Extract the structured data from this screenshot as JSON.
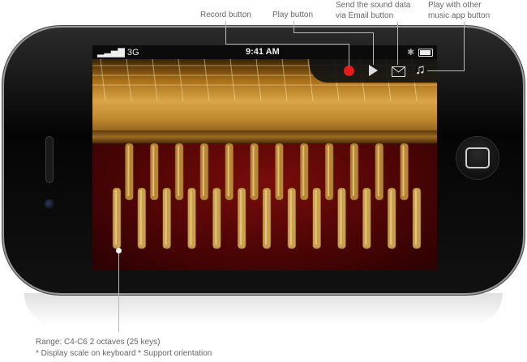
{
  "callouts": {
    "record": "Record button",
    "play": "Play button",
    "send_line1": "Send the sound data",
    "send_line2": "via Email button",
    "music_line1": "Play with other",
    "music_line2": "music app button",
    "range": "Range: C4-C6 2 octaves (25 keys)",
    "notes": "* Display scale on keyboard   * Support orientation"
  },
  "statusbar": {
    "signal": "3G",
    "time": "9:41 AM",
    "bluetooth_icon": "bluetooth-icon",
    "battery_icon": "battery-icon"
  },
  "app_buttons": {
    "record_icon": "record-icon",
    "play_icon": "play-icon",
    "mail_icon": "mail-icon",
    "music_icon": "music-note-icon",
    "record_color": "#e21b1b"
  },
  "colors": {
    "felt": "#5a0606",
    "wood": "#c8923a"
  },
  "tooth_count": 25
}
